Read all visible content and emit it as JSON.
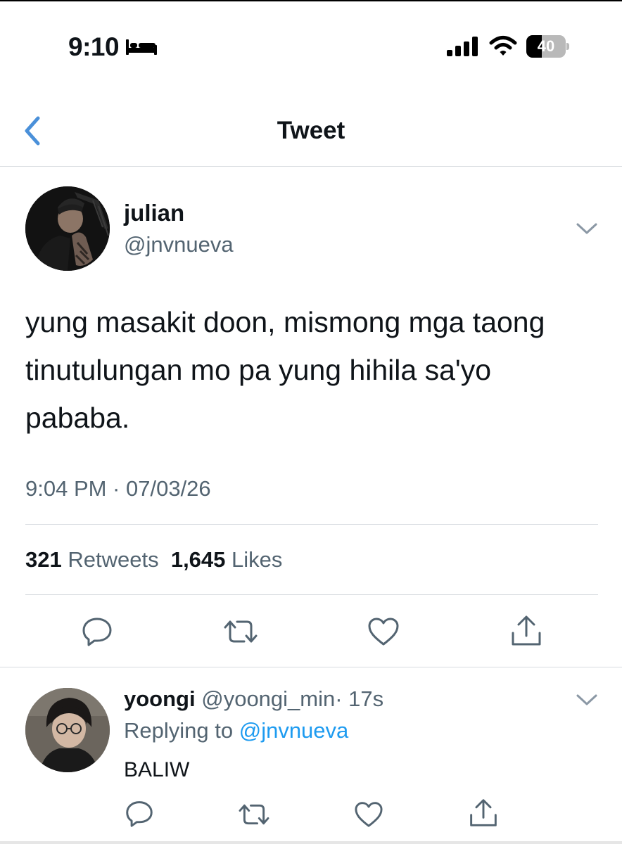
{
  "status_bar": {
    "time": "9:10",
    "battery_level": "40",
    "battery_fraction": 0.4
  },
  "header": {
    "title": "Tweet"
  },
  "tweet": {
    "author_name": "julian",
    "author_handle": "@jnvnueva",
    "text": "yung masakit doon, mismong mga taong tinutulungan mo pa yung hihila sa'yo pababa.",
    "timestamp": "9:04 PM · 07/03/26",
    "retweets_count": "321",
    "retweets_label": "Retweets",
    "likes_count": "1,645",
    "likes_label": "Likes"
  },
  "reply": {
    "author_name": "yoongi",
    "author_handle": "@yoongi_min",
    "age": "· 17s",
    "replying_prefix": "Replying to",
    "replying_to": "@jnvnueva",
    "text": "BALIW"
  },
  "icons": {
    "status": [
      "bed-icon",
      "signal-icon",
      "wifi-icon",
      "battery-icon"
    ],
    "header": [
      "back-chevron-icon"
    ],
    "tweet": [
      "chevron-down-icon"
    ],
    "actions": [
      "reply-icon",
      "retweet-icon",
      "like-icon",
      "share-icon"
    ]
  },
  "colors": {
    "accent_blue": "#1d9bf0",
    "back_arrow": "#4a90d9",
    "secondary_text": "#536471",
    "primary_text": "#0f1419",
    "divider": "#d7dbdf"
  }
}
